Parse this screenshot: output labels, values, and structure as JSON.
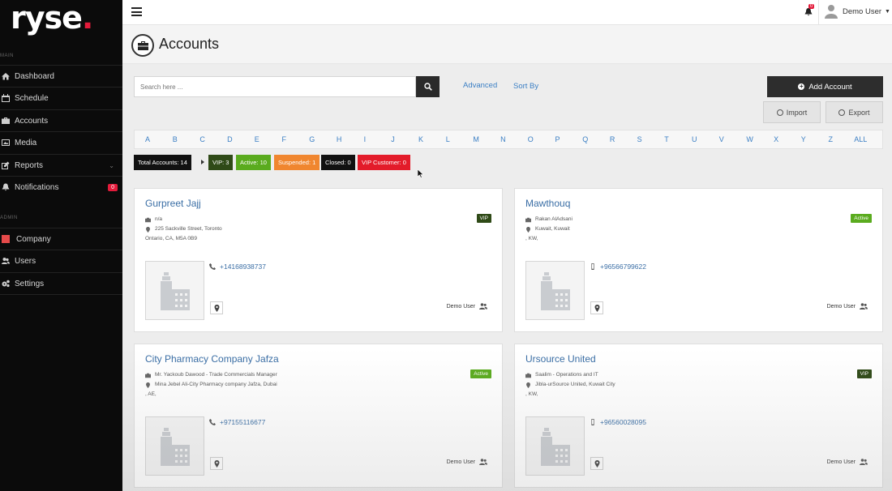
{
  "brand": {
    "name": "ryse",
    "dot": "."
  },
  "sidebar": {
    "section_main": "MAIN",
    "section_admin": "ADMIN",
    "items": [
      {
        "label": "Dashboard",
        "icon": "home-icon"
      },
      {
        "label": "Schedule",
        "icon": "calendar-icon"
      },
      {
        "label": "Accounts",
        "icon": "briefcase-icon"
      },
      {
        "label": "Media",
        "icon": "image-icon"
      },
      {
        "label": "Reports",
        "icon": "edit-icon"
      },
      {
        "label": "Notifications",
        "icon": "bell-icon",
        "badge": "0"
      },
      {
        "label": "Company",
        "icon": "building-icon"
      },
      {
        "label": "Users",
        "icon": "users-icon"
      },
      {
        "label": "Settings",
        "icon": "gears-icon"
      }
    ]
  },
  "topbar": {
    "notification_count": "0",
    "user_name": "Demo User"
  },
  "page": {
    "title": "Accounts"
  },
  "toolbar": {
    "search_placeholder": "Search here ...",
    "advanced": "Advanced",
    "sort_by": "Sort By",
    "add_account": "Add Account",
    "import": "Import",
    "export": "Export"
  },
  "alphabet": [
    "A",
    "B",
    "C",
    "D",
    "E",
    "F",
    "G",
    "H",
    "I",
    "J",
    "K",
    "L",
    "M",
    "N",
    "O",
    "P",
    "Q",
    "R",
    "S",
    "T",
    "U",
    "V",
    "W",
    "X",
    "Y",
    "Z",
    "ALL"
  ],
  "summary": {
    "total": "Total Accounts: 14",
    "vip": "VIP: 3",
    "active": "Active: 10",
    "suspended": "Suspended: 1",
    "closed": "Closed: 0",
    "vip_customer": "VIP Customer: 0"
  },
  "colors": {
    "accent": "#3b7fc4",
    "vip": "#2f4a17",
    "active": "#5aab1e",
    "suspended": "#f0862f",
    "closed": "#111111",
    "vip_customer": "#e31b2a"
  },
  "accounts": [
    {
      "name": "Gurpreet Jajj",
      "contact": "n/a",
      "address1": "225 Sackville Street, Toronto",
      "address2": "Ontario, CA, M5A 0B9",
      "status": "VIP",
      "phone": "+14168938737",
      "owner": "Demo User"
    },
    {
      "name": "Mawthouq",
      "contact": "Rakan AlAdsani",
      "address1": "Kuwait, Kuwait",
      "address2": ", KW,",
      "status": "Active",
      "phone": "+96566799622",
      "owner": "Demo User"
    },
    {
      "name": "City Pharmacy Company Jafza",
      "contact": "Mr. Yackoub Dawood - Trade Commercials Manager",
      "address1": "Mina Jebel Ali-City Pharmacy company Jafza, Dubai",
      "address2": ", AE,",
      "status": "Active",
      "phone": "+97155116677",
      "owner": "Demo User"
    },
    {
      "name": "Ursource United",
      "contact": "Saalim - Operations and IT",
      "address1": "Jibla-urSource United, Kuwait City",
      "address2": ", KW,",
      "status": "VIP",
      "phone": "+96560028095",
      "owner": "Demo User"
    }
  ]
}
